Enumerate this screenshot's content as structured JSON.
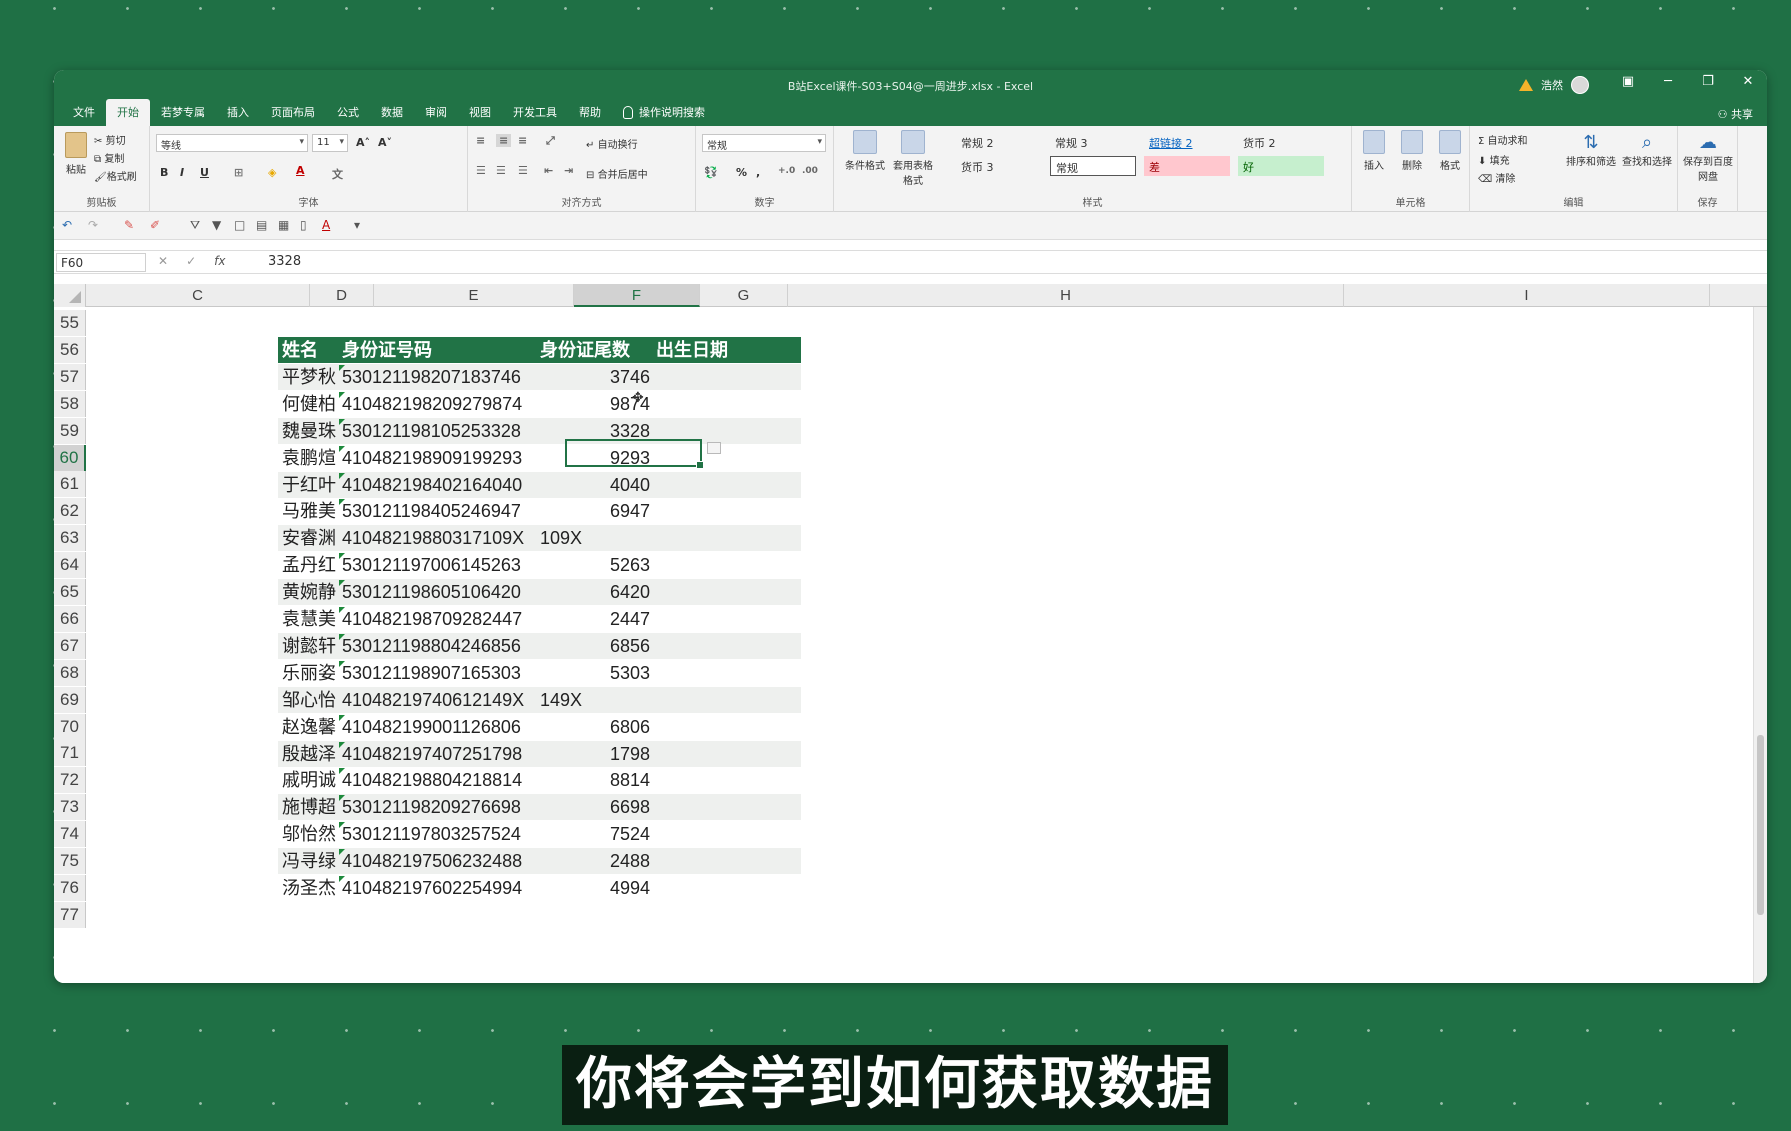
{
  "window": {
    "title": "B站Excel课件-S03+S04@一周进步.xlsx  -  Excel",
    "user_name": "浩然",
    "share_label": "共享"
  },
  "menu_tabs": [
    "文件",
    "开始",
    "若梦专属",
    "插入",
    "页面布局",
    "公式",
    "数据",
    "审阅",
    "视图",
    "开发工具",
    "帮助"
  ],
  "menu_search_hint": "操作说明搜索",
  "ribbon": {
    "clipboard": {
      "paste": "粘贴",
      "cut": "剪切",
      "copy": "复制",
      "format_painter": "格式刷",
      "label": "剪贴板"
    },
    "font": {
      "family": "等线",
      "size": "11",
      "bold": "B",
      "italic": "I",
      "underline": "U",
      "label": "字体"
    },
    "alignment": {
      "wrap": "自动换行",
      "merge": "合并后居中",
      "label": "对齐方式"
    },
    "number": {
      "format": "常规",
      "label": "数字"
    },
    "styles": {
      "cond_format": "条件格式",
      "table_format": "套用表格格式",
      "cells": [
        "常规 2",
        "常规 3",
        "超链接 2",
        "货币 2",
        "货币 3",
        "常规",
        "差",
        "好"
      ],
      "label": "样式"
    },
    "cells_group": {
      "insert": "插入",
      "delete": "删除",
      "format": "格式",
      "label": "单元格"
    },
    "editing": {
      "autosum": "自动求和",
      "fill": "填充",
      "clear": "清除",
      "sort": "排序和筛选",
      "find": "查找和选择",
      "label": "编辑"
    },
    "save": {
      "btn": "保存到百度网盘",
      "label": "保存"
    }
  },
  "formula_bar": {
    "name_box": "F60",
    "fx": "fx",
    "value": "3328"
  },
  "columns": [
    "C",
    "D",
    "E",
    "F",
    "G",
    "H",
    "I"
  ],
  "rows": [
    "55",
    "56",
    "57",
    "58",
    "59",
    "60",
    "61",
    "62",
    "63",
    "64",
    "65",
    "66",
    "67",
    "68",
    "69",
    "70",
    "71",
    "72",
    "73",
    "74",
    "75",
    "76",
    "77"
  ],
  "table": {
    "headers": [
      "姓名",
      "身份证号码",
      "身份证尾数",
      "出生日期"
    ],
    "records": [
      {
        "name": "平梦秋",
        "id": "530121198207183746",
        "tail": "3746"
      },
      {
        "name": "何健柏",
        "id": "410482198209279874",
        "tail": "9874"
      },
      {
        "name": "魏曼珠",
        "id": "530121198105253328",
        "tail": "3328"
      },
      {
        "name": "袁鹏煊",
        "id": "410482198909199293",
        "tail": "9293"
      },
      {
        "name": "于红叶",
        "id": "410482198402164040",
        "tail": "4040"
      },
      {
        "name": "马雅美",
        "id": "530121198405246947",
        "tail": "6947"
      },
      {
        "name": "安睿渊",
        "id": "41048219880317109X",
        "tail": "109X"
      },
      {
        "name": "孟丹红",
        "id": "530121197006145263",
        "tail": "5263"
      },
      {
        "name": "黄婉静",
        "id": "530121198605106420",
        "tail": "6420"
      },
      {
        "name": "袁慧美",
        "id": "410482198709282447",
        "tail": "2447"
      },
      {
        "name": "谢懿轩",
        "id": "530121198804246856",
        "tail": "6856"
      },
      {
        "name": "乐丽姿",
        "id": "530121198907165303",
        "tail": "5303"
      },
      {
        "name": "邹心怡",
        "id": "41048219740612149X",
        "tail": "149X"
      },
      {
        "name": "赵逸馨",
        "id": "410482199001126806",
        "tail": "6806"
      },
      {
        "name": "殷越泽",
        "id": "410482197407251798",
        "tail": "1798"
      },
      {
        "name": "戚明诚",
        "id": "410482198804218814",
        "tail": "8814"
      },
      {
        "name": "施博超",
        "id": "530121198209276698",
        "tail": "6698"
      },
      {
        "name": "邬怡然",
        "id": "530121197803257524",
        "tail": "7524"
      },
      {
        "name": "冯寻绿",
        "id": "410482197506232488",
        "tail": "2488"
      },
      {
        "name": "汤圣杰",
        "id": "410482197602254994",
        "tail": "4994"
      }
    ]
  },
  "subtitle": "你将会学到如何获取数据",
  "colors": {
    "excel_green": "#217346",
    "background": "#1f7045",
    "stripe": "#eef0ee"
  }
}
